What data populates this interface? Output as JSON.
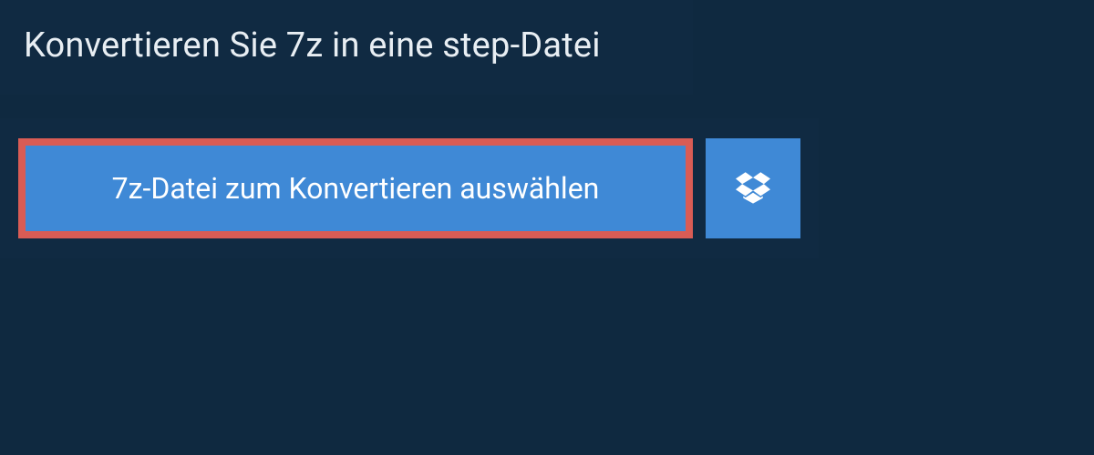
{
  "header": {
    "title": "Konvertieren Sie 7z in eine step-Datei"
  },
  "actions": {
    "select_file_label": "7z-Datei zum Konvertieren auswählen",
    "dropbox_icon_name": "dropbox-icon"
  },
  "colors": {
    "page_bg": "#0f2940",
    "panel_bg": "#102a42",
    "button_bg": "#3f89d6",
    "highlight_border": "#d95c55",
    "text_light": "#ffffff"
  }
}
